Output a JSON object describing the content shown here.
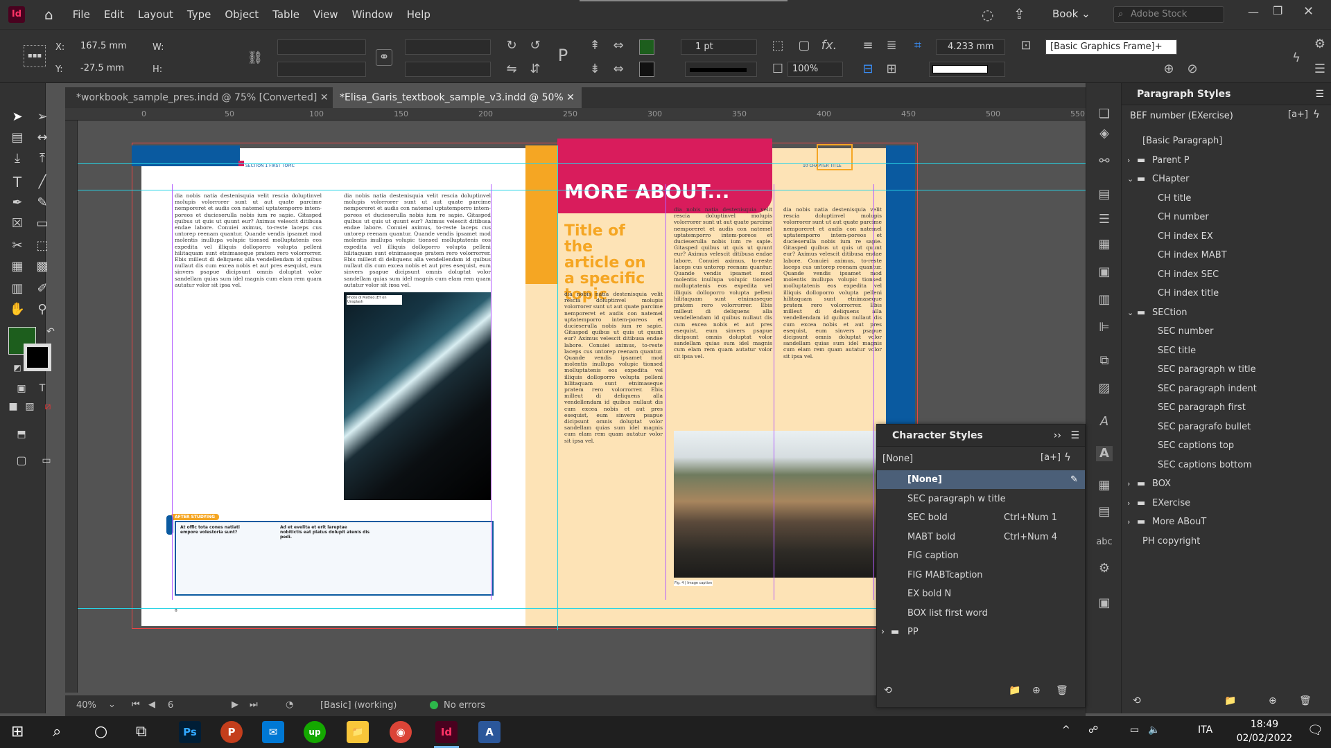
{
  "app": {
    "logo": "Id",
    "menu": [
      "File",
      "Edit",
      "Layout",
      "Type",
      "Object",
      "Table",
      "View",
      "Window",
      "Help"
    ],
    "workspace": "Book",
    "search_placeholder": "Adobe Stock"
  },
  "control": {
    "x": "167.5 mm",
    "y": "-27.5 mm",
    "x_label": "X:",
    "y_label": "Y:",
    "w_label": "W:",
    "h_label": "H:",
    "stroke_weight": "1 pt",
    "opacity": "100%",
    "gutter": "4.233 mm",
    "frame_style": "[Basic Graphics Frame]+",
    "fx": "fx."
  },
  "tabs": [
    {
      "label": "*workbook_sample_pres.indd @ 75% [Converted]"
    },
    {
      "label": "*Elisa_Garis_textbook_sample_v3.indd @ 50%"
    }
  ],
  "ruler": [
    "0",
    "50",
    "100",
    "150",
    "200",
    "250",
    "300",
    "350",
    "400",
    "450",
    "500",
    "550"
  ],
  "status": {
    "zoom": "40%",
    "page": "6",
    "style": "[Basic] (working)",
    "errors": "No errors"
  },
  "doc": {
    "left_head": "SECTION 1 FIRST TOPIC",
    "right_head": "10  CHAPTER TITLE",
    "more_about": "MORE ABOUT...",
    "article_title": "Title of the article on a specific topic",
    "photo_credit": "Photo di Matteo JET on Unsplash",
    "fig_caption": "Fig. 4 | Image caption",
    "after_studying": "AFTER STUDYING",
    "q1": "At offic tota cones natiati empore volestoria sunt?",
    "q2": "Ad et evelita et erit lareptae nobitictis eat platus dolupit atenis dis pedi.",
    "page_num": "8",
    "body": "dia nobis natia destenisquia velit rescia doluptinvel molupis volorrorer sunt ut aut quate parcime nemporeret et audis con natemel uptatemporro intem-poreos et ducieserulla nobis ium re sapie. Gitasped quibus ut quis ut quunt eur? Aximus velescit ditibusa endae labore. Conuiei aximus, to-reste laceps cus untorep reenam quantur. Quande vendis ipsamet mod molentis inullupa volupic tionsed molluptatenis eos expedita vel illiquis dolloporro volupta pelleni hilitaquam sunt etnimaseque pratem rero volorrorrer. Ebis milleut di deliquens alla vendellendam id quibus nullaut dis cum excea nobis et aut pres esequist, eum sinvers psapue dicipsunt omnis doluptat volor sandellam quias sum idel magnis cum elam rem quam autatur volor sit ipsa vel."
  },
  "paragraph_styles": {
    "title": "Paragraph Styles",
    "current": "BEF number (EXercise)",
    "items": [
      {
        "label": "[Basic Paragraph]",
        "level": 1,
        "folder": false
      },
      {
        "label": "Parent P",
        "level": 0,
        "folder": true,
        "open": false
      },
      {
        "label": "CHapter",
        "level": 0,
        "folder": true,
        "open": true
      },
      {
        "label": "CH title",
        "level": 2,
        "folder": false
      },
      {
        "label": "CH number",
        "level": 2,
        "folder": false
      },
      {
        "label": "CH index EX",
        "level": 2,
        "folder": false
      },
      {
        "label": "CH index MABT",
        "level": 2,
        "folder": false
      },
      {
        "label": "CH index SEC",
        "level": 2,
        "folder": false
      },
      {
        "label": "CH index title",
        "level": 2,
        "folder": false
      },
      {
        "label": "SECtion",
        "level": 0,
        "folder": true,
        "open": true
      },
      {
        "label": "SEC number",
        "level": 2,
        "folder": false
      },
      {
        "label": "SEC title",
        "level": 2,
        "folder": false
      },
      {
        "label": "SEC paragraph w title",
        "level": 2,
        "folder": false
      },
      {
        "label": "SEC paragraph indent",
        "level": 2,
        "folder": false
      },
      {
        "label": "SEC paragraph first",
        "level": 2,
        "folder": false
      },
      {
        "label": "SEC paragrafo bullet",
        "level": 2,
        "folder": false
      },
      {
        "label": "SEC captions top",
        "level": 2,
        "folder": false
      },
      {
        "label": "SEC captions bottom",
        "level": 2,
        "folder": false
      },
      {
        "label": "BOX",
        "level": 0,
        "folder": true,
        "open": false
      },
      {
        "label": "EXercise",
        "level": 0,
        "folder": true,
        "open": false
      },
      {
        "label": "More ABouT",
        "level": 0,
        "folder": true,
        "open": false
      },
      {
        "label": "PH copyright",
        "level": 1,
        "folder": false
      }
    ]
  },
  "character_styles": {
    "title": "Character Styles",
    "current": "[None]",
    "items": [
      {
        "label": "[None]",
        "shortcut": "",
        "selected": true
      },
      {
        "label": "SEC paragraph w title",
        "shortcut": ""
      },
      {
        "label": "SEC bold",
        "shortcut": "Ctrl+Num 1"
      },
      {
        "label": "MABT bold",
        "shortcut": "Ctrl+Num 4"
      },
      {
        "label": "FIG caption",
        "shortcut": ""
      },
      {
        "label": "FIG MABTcaption",
        "shortcut": ""
      },
      {
        "label": "EX bold N",
        "shortcut": ""
      },
      {
        "label": "BOX list first word",
        "shortcut": ""
      },
      {
        "label": "PP",
        "shortcut": "",
        "folder": true
      }
    ]
  },
  "taskbar": {
    "apps": [
      "Ps",
      "P",
      "✉",
      "up",
      "📁",
      "◉",
      "Id",
      "A"
    ],
    "lang": "ITA",
    "time": "18:49",
    "date": "02/02/2022"
  },
  "colors": {
    "accent_magenta": "#d91c5c",
    "accent_orange": "#f5a623",
    "accent_blue": "#0a5aa0",
    "bg_peach": "#fde3b6",
    "guide_cyan": "#27d4e6",
    "ui_dark": "#323232"
  }
}
